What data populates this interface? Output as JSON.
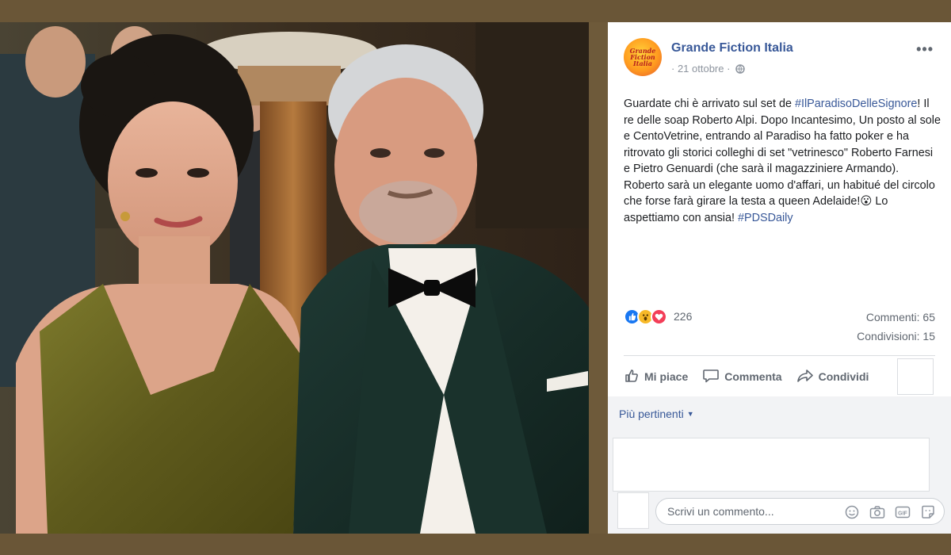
{
  "post": {
    "page_name": "Grande Fiction Italia",
    "avatar_text": "Grande\nFiction\nItalia",
    "date": "· 21 ottobre ·",
    "more": "•••",
    "text_1": "Guardate chi è arrivato sul set de ",
    "hashtag_1": "#IlParadisoDelleSignore",
    "text_2": "! Il re delle soap Roberto Alpi. Dopo Incantesimo, Un posto al sole e CentoVetrine, entrando al Paradiso ha fatto poker e ha ritrovato gli storici colleghi di set \"vetrinesco\" Roberto Farnesi e Pietro Genuardi (che sarà il magazziniere Armando).",
    "text_3": "Roberto sarà un elegante uomo d'affari, un habitué del circolo che forse farà girare la testa a queen Adelaide!😮 Lo aspettiamo con ansia! ",
    "hashtag_2": "#PDSDaily"
  },
  "stats": {
    "reaction_count": "226",
    "comments": "Commenti: 65",
    "shares": "Condivisioni: 15"
  },
  "actions": {
    "like": "Mi piace",
    "comment": "Commenta",
    "share": "Condividi"
  },
  "comments": {
    "sort_label": "Più pertinenti",
    "composer_placeholder": "Scrivi un commento..."
  },
  "colors": {
    "brand_link": "#385898",
    "like_blue": "#1877f2",
    "frame": "#6a5637"
  },
  "icons": [
    "globe-icon",
    "more-icon",
    "like-reaction-icon",
    "wow-reaction-icon",
    "love-reaction-icon",
    "thumbs-up-icon",
    "comment-bubble-icon",
    "share-arrow-icon",
    "emoji-icon",
    "camera-icon",
    "gif-icon",
    "sticker-icon",
    "caret-down-icon"
  ]
}
